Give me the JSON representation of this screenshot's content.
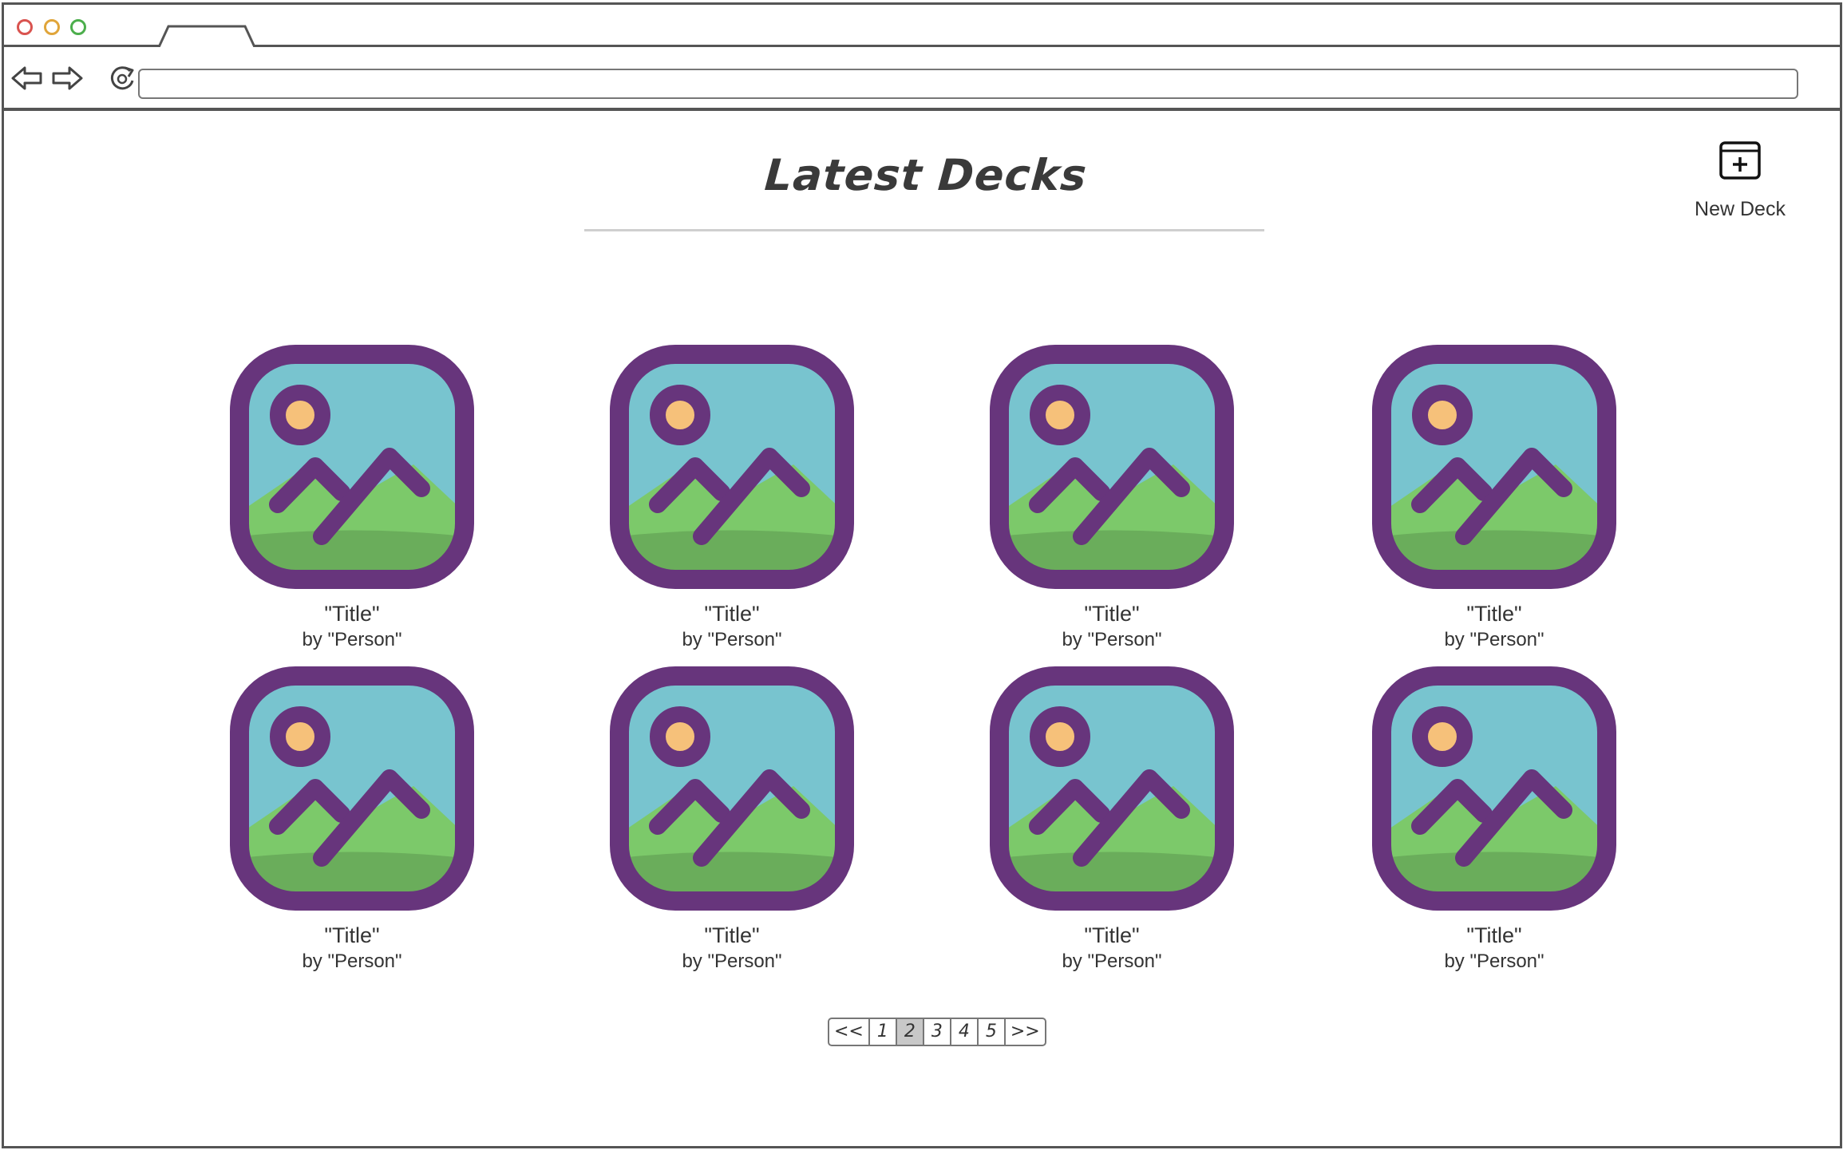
{
  "browser": {
    "url": "",
    "colors": {
      "close": "#d9534f",
      "minimize": "#e0a53a",
      "maximize": "#4cae4c"
    }
  },
  "page": {
    "title": "Latest Decks",
    "new_deck_label": "New Deck"
  },
  "decks": [
    {
      "title": "\"Title\"",
      "author": "by \"Person\""
    },
    {
      "title": "\"Title\"",
      "author": "by \"Person\""
    },
    {
      "title": "\"Title\"",
      "author": "by \"Person\""
    },
    {
      "title": "\"Title\"",
      "author": "by \"Person\""
    },
    {
      "title": "\"Title\"",
      "author": "by \"Person\""
    },
    {
      "title": "\"Title\"",
      "author": "by \"Person\""
    },
    {
      "title": "\"Title\"",
      "author": "by \"Person\""
    },
    {
      "title": "\"Title\"",
      "author": "by \"Person\""
    }
  ],
  "pagination": {
    "prev": "<<",
    "pages": [
      "1",
      "2",
      "3",
      "4",
      "5"
    ],
    "next": ">>",
    "current": "2"
  },
  "thumbnail_colors": {
    "frame": "#67357c",
    "sky": "#78c4cf",
    "hill": "#7cc96a",
    "ground": "#6aad5b",
    "sun": "#f6c17a"
  }
}
